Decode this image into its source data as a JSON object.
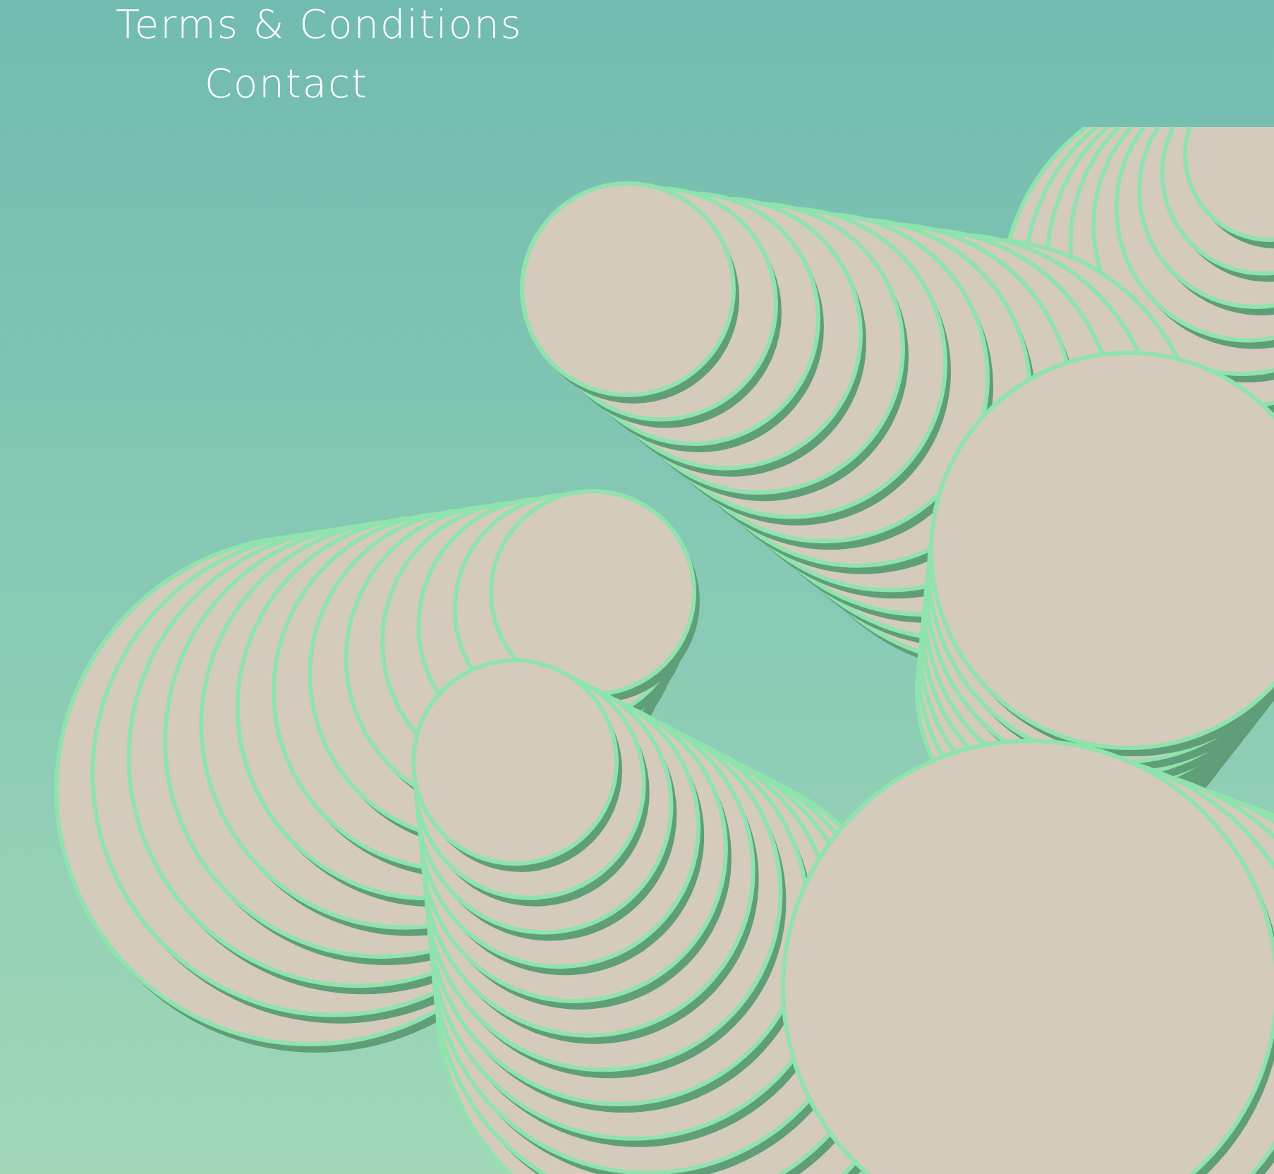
{
  "footer_links": [
    {
      "label": "Terms & Conditions"
    },
    {
      "label": "Contact"
    }
  ]
}
